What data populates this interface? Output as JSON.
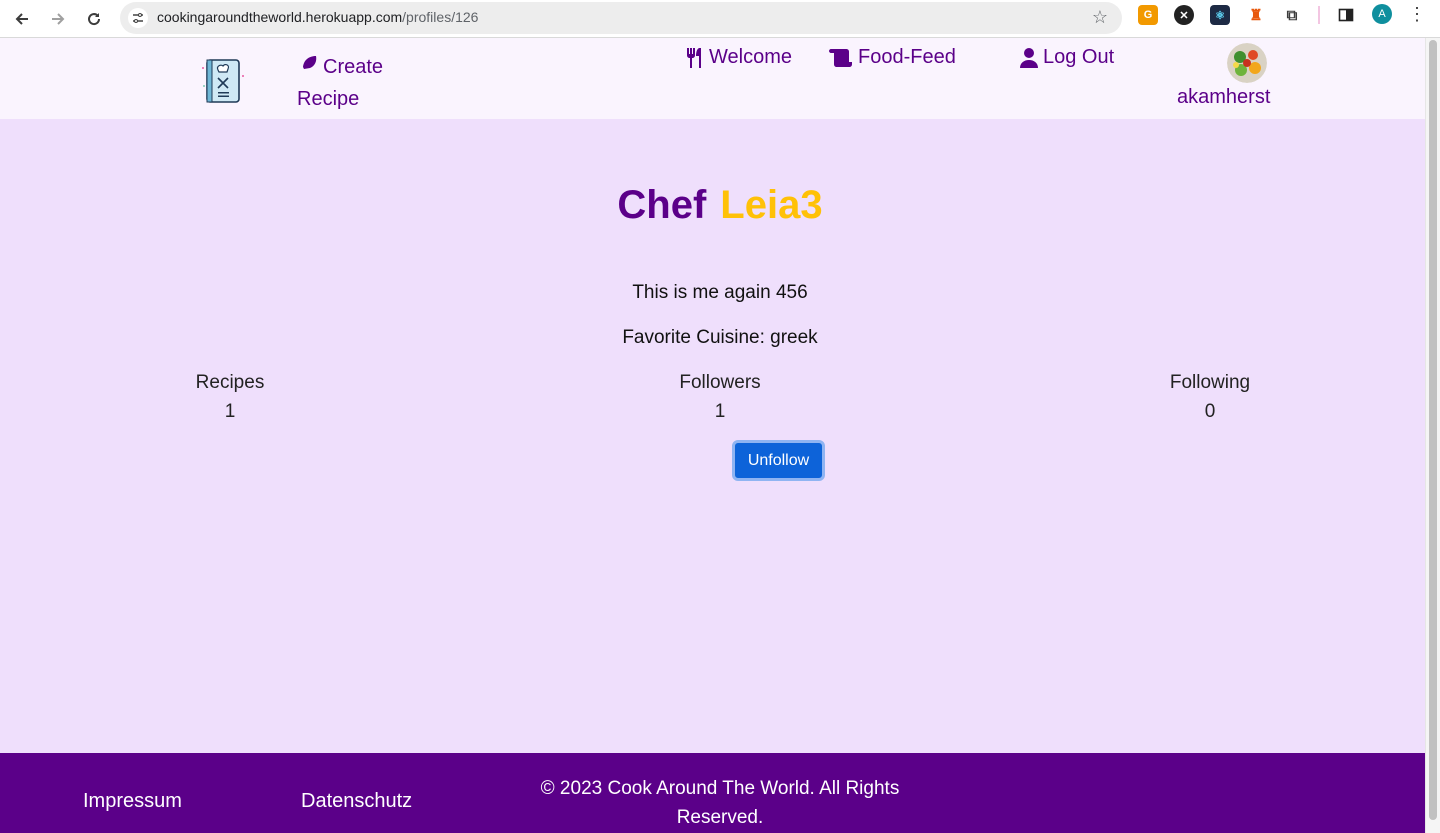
{
  "browser": {
    "url_host": "cookingaroundtheworld.herokuapp.com",
    "url_path": "/profiles/126",
    "profile_initial": "A"
  },
  "navbar": {
    "create_label": "Create Recipe",
    "welcome_label": "Welcome",
    "feed_label": "Food-Feed",
    "logout_label": "Log Out",
    "username": "akamherst"
  },
  "profile": {
    "title_prefix": "Chef",
    "chef_name": "Leia3",
    "bio": "This is me again 456",
    "favorite_cuisine": "Favorite Cuisine: greek",
    "stats": [
      {
        "label": "Recipes",
        "value": "1"
      },
      {
        "label": "Followers",
        "value": "1"
      },
      {
        "label": "Following",
        "value": "0"
      }
    ],
    "unfollow_label": "Unfollow"
  },
  "footer": {
    "impressum": "Impressum",
    "datenschutz": "Datenschutz",
    "copyright": "© 2023 Cook Around The World. All Rights Reserved."
  },
  "colors": {
    "brand_purple": "#5b0089",
    "accent_yellow": "#ffc107",
    "page_bg": "#efdffc",
    "button_blue": "#0d63d9"
  }
}
